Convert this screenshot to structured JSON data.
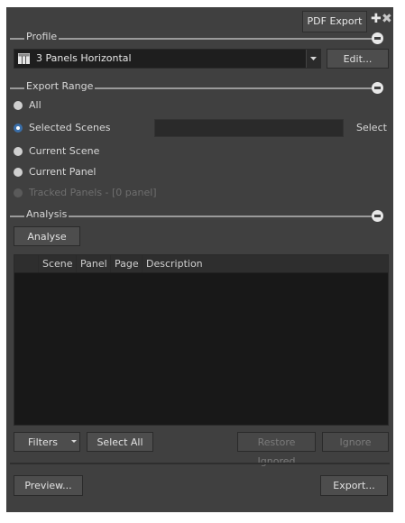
{
  "window": {
    "tab_title": "PDF Export",
    "pin_icon": "pin-plus-icon",
    "close_icon": "close-icon"
  },
  "profile": {
    "section_label": "Profile",
    "selected": "3 Panels Horizontal",
    "layout_icon": "panel-grid-icon",
    "edit_label": "Edit..."
  },
  "export_range": {
    "section_label": "Export Range",
    "options": [
      {
        "label": "All",
        "checked": false,
        "disabled": false
      },
      {
        "label": "Selected Scenes",
        "checked": true,
        "disabled": false
      },
      {
        "label": "Current Scene",
        "checked": false,
        "disabled": false
      },
      {
        "label": "Current Panel",
        "checked": false,
        "disabled": false
      },
      {
        "label": "Tracked Panels - [0 panel]",
        "checked": false,
        "disabled": true
      }
    ],
    "selected_scenes_value": "",
    "select_label": "Select"
  },
  "analysis": {
    "section_label": "Analysis",
    "analyse_label": "Analyse",
    "columns": [
      "",
      "Scene",
      "Panel",
      "Page",
      "Description"
    ],
    "rows": []
  },
  "footer": {
    "filters_label": "Filters",
    "select_all_label": "Select All",
    "restore_ignored_label": "Restore Ignored",
    "ignore_label": "Ignore",
    "preview_label": "Preview...",
    "export_label": "Export..."
  },
  "colors": {
    "panel_bg": "#404040",
    "table_bg": "#181818",
    "radio_accent": "#3a6ea8"
  }
}
